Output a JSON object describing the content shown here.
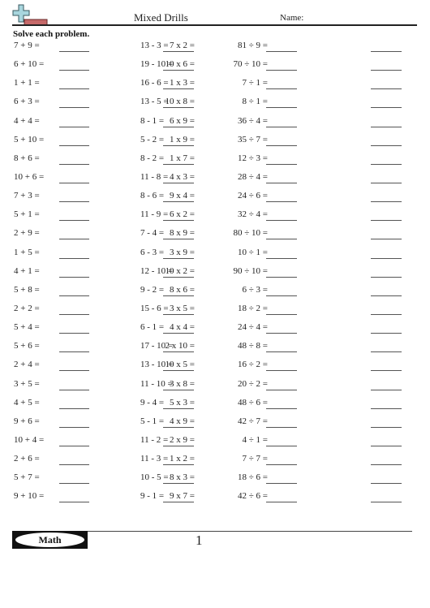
{
  "header": {
    "title": "Mixed Drills",
    "name_label": "Name:",
    "logo_icon": "plus-minus-icon",
    "colors": {
      "plus": "#9fd0d8",
      "minus": "#c66a6a"
    }
  },
  "instructions": "Solve each problem.",
  "problems": [
    [
      "7 + 9 =",
      "13 - 3 =",
      "7 x 2 =",
      "81 ÷ 9 ="
    ],
    [
      "6 + 10 =",
      "19 - 10 =",
      "10 x 6 =",
      "70 ÷ 10 ="
    ],
    [
      "1 + 1 =",
      "16 - 6 =",
      "1 x 3 =",
      "7 ÷ 1 ="
    ],
    [
      "6 + 3 =",
      "13 - 5 =",
      "10 x 8 =",
      "8 ÷ 1 ="
    ],
    [
      "4 + 4 =",
      "8 - 1 =",
      "6 x 9 =",
      "36 ÷ 4 ="
    ],
    [
      "5 + 10 =",
      "5 - 2 =",
      "1 x 9 =",
      "35 ÷ 7 ="
    ],
    [
      "8 + 6 =",
      "8 - 2 =",
      "1 x 7 =",
      "12 ÷ 3 ="
    ],
    [
      "10 + 6 =",
      "11 - 8 =",
      "4 x 3 =",
      "28 ÷ 4 ="
    ],
    [
      "7 + 3 =",
      "8 - 6 =",
      "9 x 4 =",
      "24 ÷ 6 ="
    ],
    [
      "5 + 1 =",
      "11 - 9 =",
      "6 x 2 =",
      "32 ÷ 4 ="
    ],
    [
      "2 + 9 =",
      "7 - 4 =",
      "8 x 9 =",
      "80 ÷ 10 ="
    ],
    [
      "1 + 5 =",
      "6 - 3 =",
      "3 x 9 =",
      "10 ÷ 1 ="
    ],
    [
      "4 + 1 =",
      "12 - 10 =",
      "10 x 2 =",
      "90 ÷ 10 ="
    ],
    [
      "5 + 8 =",
      "9 - 2 =",
      "8 x 6 =",
      "6 ÷ 3 ="
    ],
    [
      "2 + 2 =",
      "15 - 6 =",
      "3 x 5 =",
      "18 ÷ 2 ="
    ],
    [
      "5 + 4 =",
      "6 - 1 =",
      "4 x 4 =",
      "24 ÷ 4 ="
    ],
    [
      "5 + 6 =",
      "17 - 10 =",
      "2 x 10 =",
      "48 ÷ 8 ="
    ],
    [
      "2 + 4 =",
      "13 - 10 =",
      "10 x 5 =",
      "16 ÷ 2 ="
    ],
    [
      "3 + 5 =",
      "11 - 10 =",
      "3 x 8 =",
      "20 ÷ 2 ="
    ],
    [
      "4 + 5 =",
      "9 - 4 =",
      "5 x 3 =",
      "48 ÷ 6 ="
    ],
    [
      "9 + 6 =",
      "5 - 1 =",
      "4 x 9 =",
      "42 ÷ 7 ="
    ],
    [
      "10 + 4 =",
      "11 - 2 =",
      "2 x 9 =",
      "4 ÷ 1 ="
    ],
    [
      "2 + 6 =",
      "11 - 3 =",
      "1 x 2 =",
      "7 ÷ 7 ="
    ],
    [
      "5 + 7 =",
      "10 - 5 =",
      "8 x 3 =",
      "18 ÷ 6 ="
    ],
    [
      "9 + 10 =",
      "9 - 1 =",
      "9 x 7 =",
      "42 ÷ 6 ="
    ]
  ],
  "footer": {
    "badge_label": "Math",
    "page_number": "1"
  }
}
